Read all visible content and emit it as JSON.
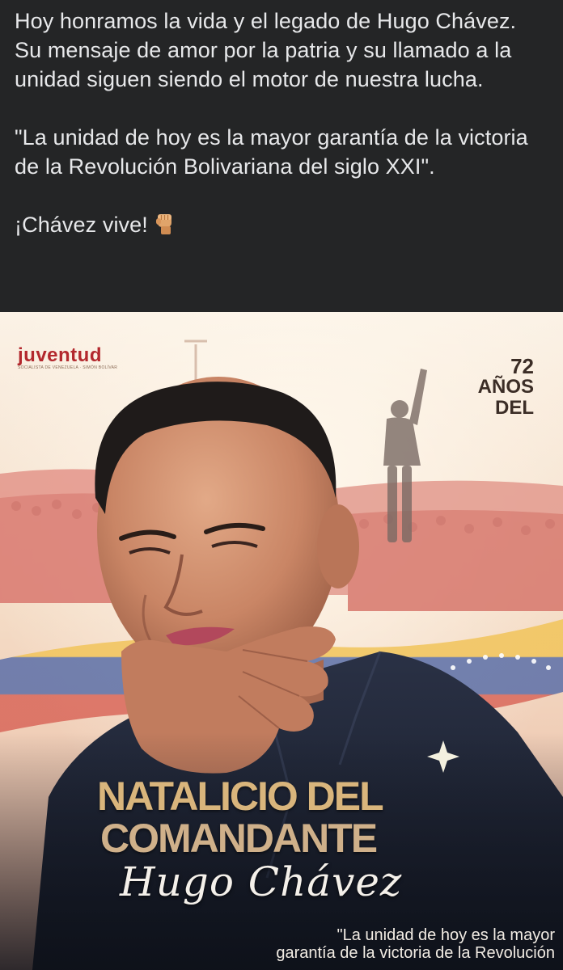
{
  "post": {
    "paragraphs": [
      "Hoy honramos la vida y el legado de Hugo Chávez. Su mensaje de amor por la patria y su llamado a la unidad siguen siendo el motor de nuestra lucha.",
      "\"La unidad de hoy es la mayor garantía de la victoria de la Revolución Bolivariana del siglo XXI\"."
    ],
    "closing": "¡Chávez vive!",
    "closing_icon": "raised-fist-icon"
  },
  "image": {
    "logo_text": "juventud",
    "logo_subtext": "SOCIALISTA DE VENEZUELA · SIMÓN BOLÍVAR",
    "anniversary_number": "72",
    "anniversary_word1": "AÑOS",
    "anniversary_word2": "DEL",
    "headline_line1": "NATALICIO DEL",
    "headline_line2": "COMANDANTE",
    "signature": "Hugo Chávez",
    "quote_line1": "\"La unidad de hoy es la mayor",
    "quote_line2": "garantía de la victoria de la Revolución",
    "colors": {
      "dark_bg": "#242526",
      "text_light": "#e4e6eb",
      "warm_bg": "#f3e7d7",
      "crowd_red": "#d9786f",
      "headline_gold": "#d2ae73",
      "jacket_navy": "#1c2233",
      "flag_yellow": "#f1c45a"
    }
  }
}
